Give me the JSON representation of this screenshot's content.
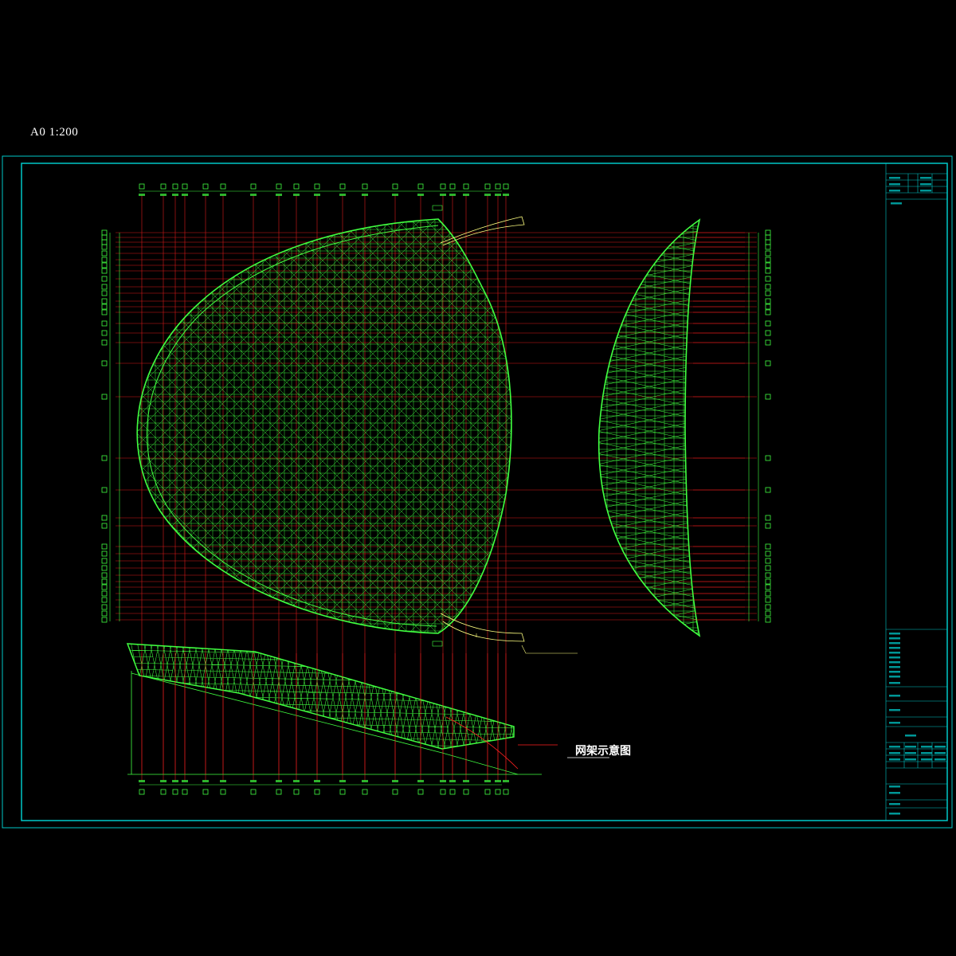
{
  "sheet": {
    "scale_label": "A0 1:200",
    "frame_color": "#00c8c8",
    "grid_line_color": "#ff2020",
    "truss_color": "#40ff40",
    "annotation_color": "#ffff80"
  },
  "drawing": {
    "caption": "网架示意图"
  },
  "title_block": {
    "lines": []
  }
}
